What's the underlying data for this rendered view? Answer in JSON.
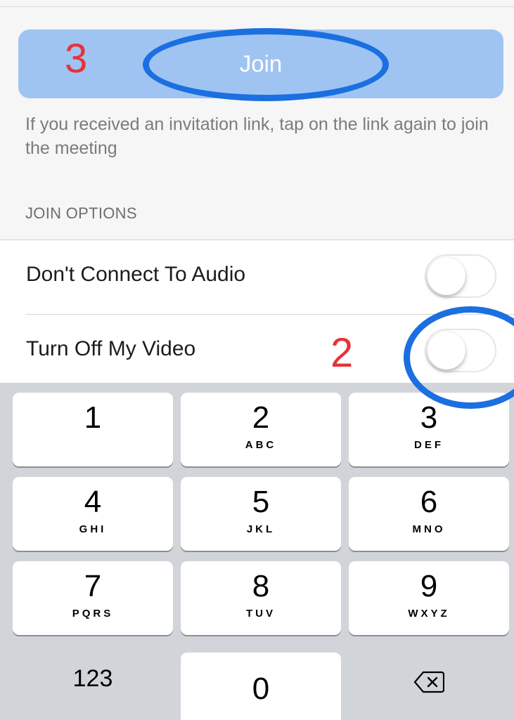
{
  "join": {
    "button_label": "Join",
    "step_number": "3",
    "hint": "If you received an invitation link, tap on the link again to join the meeting"
  },
  "join_options": {
    "header": "JOIN OPTIONS",
    "items": [
      {
        "label": "Don't Connect To Audio",
        "enabled": false
      },
      {
        "label": "Turn Off My Video",
        "enabled": false,
        "step_number": "2"
      }
    ]
  },
  "keypad": {
    "keys": [
      {
        "digit": "1",
        "letters": ""
      },
      {
        "digit": "2",
        "letters": "ABC"
      },
      {
        "digit": "3",
        "letters": "DEF"
      },
      {
        "digit": "4",
        "letters": "GHI"
      },
      {
        "digit": "5",
        "letters": "JKL"
      },
      {
        "digit": "6",
        "letters": "MNO"
      },
      {
        "digit": "7",
        "letters": "PQRS"
      },
      {
        "digit": "8",
        "letters": "TUV"
      },
      {
        "digit": "9",
        "letters": "WXYZ"
      }
    ],
    "mode_label": "123",
    "zero": "0",
    "delete_icon": "backspace-icon"
  },
  "colors": {
    "join_button": "#9fc4f2",
    "annotation_circle": "#1b6fe0",
    "annotation_number": "#e6323a"
  }
}
